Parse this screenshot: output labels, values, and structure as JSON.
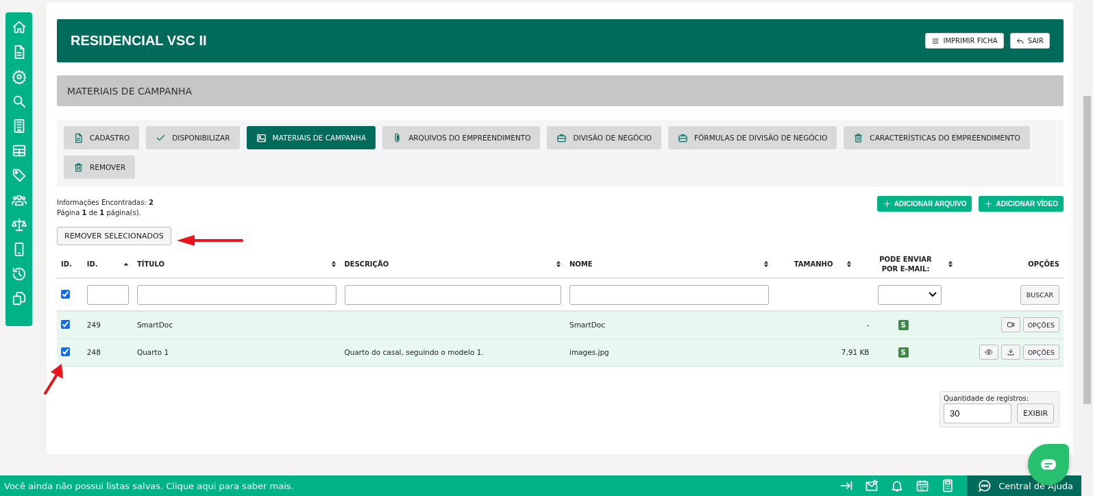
{
  "header": {
    "title": "RESIDENCIAL VSC II",
    "buttons": [
      {
        "label": "IMPRIMIR FICHA",
        "kind": "print"
      },
      {
        "label": "SAIR",
        "kind": "back"
      }
    ]
  },
  "section_title": "MATERIAIS DE CAMPANHA",
  "tabs": [
    {
      "label": "CADASTRO",
      "kind": "document",
      "selected": false
    },
    {
      "label": "DISPONIBILIZAR",
      "kind": "check",
      "selected": false
    },
    {
      "label": "MATERIAIS DE CAMPANHA",
      "kind": "image",
      "selected": true
    },
    {
      "label": "ARQUIVOS DO EMPREENDIMENTO",
      "kind": "clip",
      "selected": false
    },
    {
      "label": "DIVISÃO DE NEGÓCIO",
      "kind": "briefcase",
      "selected": false
    },
    {
      "label": "FÓRMULAS DE DIVISÃO DE NEGÓCIO",
      "kind": "briefcase",
      "selected": false
    },
    {
      "label": "CARACTERÍSTICAS DO EMPREENDIMENTO",
      "kind": "trash",
      "selected": false
    },
    {
      "label": "REMOVER",
      "kind": "trash",
      "selected": false
    }
  ],
  "summary": {
    "found": "Informações Encontradas: **2**",
    "page": "Página **1** de **1** página(s)."
  },
  "add_buttons": [
    "ADICIONAR ARQUIVO",
    "ADICIONAR VÍDEO"
  ],
  "remove_selected_button": "REMOVER SELECIONADOS",
  "table": {
    "columns": [
      {
        "label": "ID.",
        "kind": "plain"
      },
      {
        "label": "ID.",
        "kind": "ascending"
      },
      {
        "label": "TÍTULO",
        "kind": "sortable"
      },
      {
        "label": "DESCRIÇÃO",
        "kind": "sortable"
      },
      {
        "label": "NOME",
        "kind": "sortable"
      },
      {
        "label": "TAMANHO",
        "kind": "sortable"
      },
      {
        "label": "PODE ENVIAR POR E-MAIL:",
        "kind": "sortable"
      },
      {
        "label": "OPÇÕES",
        "kind": "plain"
      }
    ],
    "filter": {
      "select_all_checked": true,
      "search_button": "BUSCAR"
    },
    "rows": [
      {
        "checked": true,
        "id": "249",
        "title": "SmartDoc",
        "description": "",
        "name": "SmartDoc",
        "size": "-",
        "email": "S",
        "actions": [
          {
            "kind": "video"
          }
        ],
        "options": "OPÇÕES"
      },
      {
        "checked": true,
        "id": "248",
        "title": "Quarto 1",
        "description": "Quarto do casal, seguindo o modelo 1.",
        "name": "images.jpg",
        "size": "7,91 KB",
        "email": "S",
        "actions": [
          {
            "kind": "eye"
          },
          {
            "kind": "download"
          }
        ],
        "options": "OPÇÕES"
      }
    ]
  },
  "page_size": {
    "label": "Quantidade de registros:",
    "value": "30",
    "button": "EXIBIR"
  },
  "status_bar": {
    "message": "Você ainda não possui listas salvas. Clique aqui para saber mais.",
    "help_label": "Central de Ajuda"
  }
}
